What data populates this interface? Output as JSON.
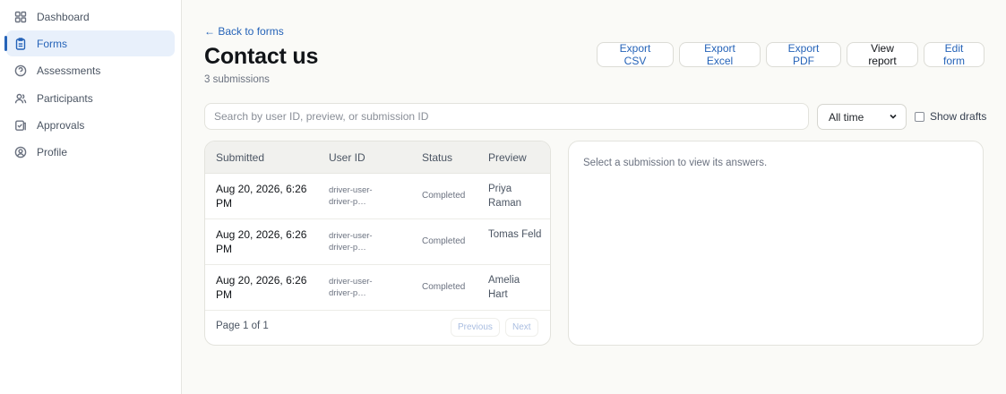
{
  "sidebar": {
    "items": [
      {
        "label": "Dashboard",
        "icon": "grid-icon",
        "active": false
      },
      {
        "label": "Forms",
        "icon": "clipboard-icon",
        "active": true
      },
      {
        "label": "Assessments",
        "icon": "help-circle-icon",
        "active": false
      },
      {
        "label": "Participants",
        "icon": "users-icon",
        "active": false
      },
      {
        "label": "Approvals",
        "icon": "approval-icon",
        "active": false
      },
      {
        "label": "Profile",
        "icon": "user-circle-icon",
        "active": false
      }
    ]
  },
  "header": {
    "back_label": "← Back to forms",
    "title": "Contact us",
    "submission_count": "3 submissions"
  },
  "toolbar": {
    "export_csv": "Export CSV",
    "export_excel": "Export Excel",
    "export_pdf": "Export PDF",
    "view_report": "View report",
    "edit_form": "Edit form"
  },
  "filters": {
    "search_placeholder": "Search by user ID, preview, or submission ID",
    "time_range": "All time",
    "show_drafts_label": "Show drafts",
    "show_drafts_checked": false
  },
  "table": {
    "columns": [
      "Submitted",
      "User ID",
      "Status",
      "Preview"
    ],
    "rows": [
      {
        "submitted": "Aug 20, 2026, 6:26 PM",
        "user_id": "driver-user-driver-p…",
        "status": "Completed",
        "preview": "Priya Raman"
      },
      {
        "submitted": "Aug 20, 2026, 6:26 PM",
        "user_id": "driver-user-driver-p…",
        "status": "Completed",
        "preview": "Tomas Feld"
      },
      {
        "submitted": "Aug 20, 2026, 6:26 PM",
        "user_id": "driver-user-driver-p…",
        "status": "Completed",
        "preview": "Amelia Hart"
      }
    ],
    "pagination": {
      "label": "Page 1 of 1",
      "previous": "Previous",
      "next": "Next"
    }
  },
  "detail": {
    "empty_message": "Select a submission to view its answers."
  },
  "colors": {
    "accent": "#2563b8",
    "active_bg": "#e8f0fb",
    "page_bg": "#fafaf7"
  }
}
